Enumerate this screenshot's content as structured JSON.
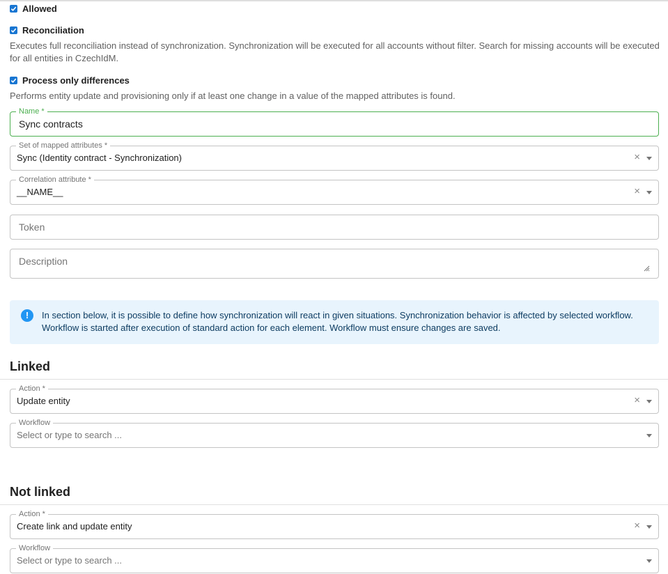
{
  "checkboxes": {
    "allowed": {
      "label": "Allowed",
      "checked": true
    },
    "reconciliation": {
      "label": "Reconciliation",
      "checked": true,
      "help": "Executes full reconciliation instead of synchronization. Synchronization will be executed for all accounts without filter. Search for missing accounts will be executed for all entities in CzechIdM."
    },
    "process_differences": {
      "label": "Process only differences",
      "checked": true,
      "help": "Performs entity update and provisioning only if at least one change in a value of the mapped attributes is found."
    }
  },
  "fields": {
    "name": {
      "label": "Name *",
      "value": "Sync contracts"
    },
    "mapping": {
      "label": "Set of mapped attributes *",
      "value": "Sync (Identity contract - Synchronization)"
    },
    "correlation": {
      "label": "Correlation attribute *",
      "value": "__NAME__"
    },
    "token": {
      "placeholder": "Token"
    },
    "description": {
      "placeholder": "Description"
    }
  },
  "alert": {
    "text": "In section below, it is possible to define how synchronization will react in given situations. Synchronization behavior is affected by selected workflow. Workflow is started after execution of standard action for each element. Workflow must ensure changes are saved."
  },
  "sections": {
    "linked": {
      "title": "Linked",
      "action_label": "Action *",
      "action_value": "Update entity",
      "workflow_label": "Workflow",
      "workflow_placeholder": "Select or type to search ..."
    },
    "not_linked": {
      "title": "Not linked",
      "action_label": "Action *",
      "action_value": "Create link and update entity",
      "workflow_label": "Workflow",
      "workflow_placeholder": "Select or type to search ..."
    }
  },
  "icons": {
    "clear": "×",
    "info": "!"
  },
  "colors": {
    "primary": "#1976d2",
    "focus": "#4caf50",
    "info_bg": "#e8f4fd",
    "info_icon": "#2196f3"
  }
}
